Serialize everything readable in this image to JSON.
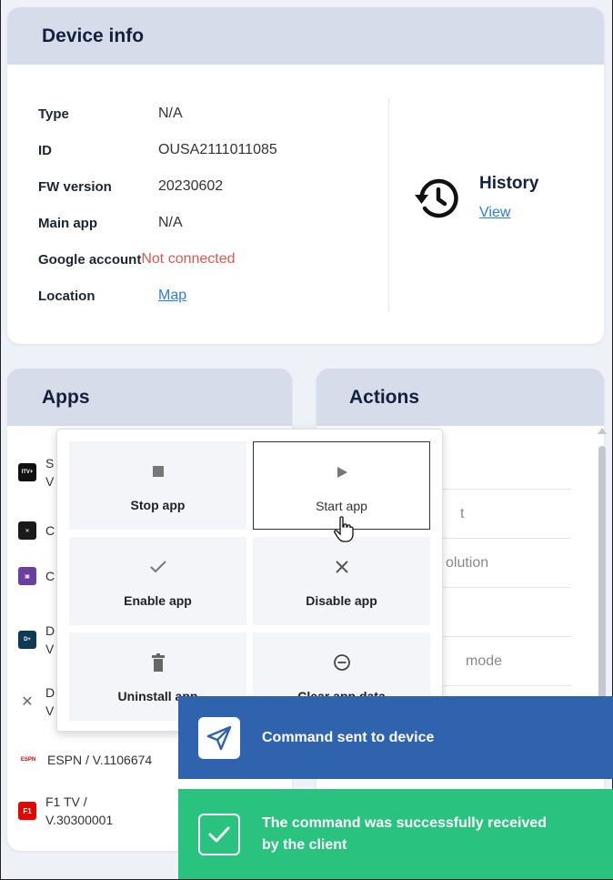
{
  "device_info": {
    "title": "Device info",
    "rows": [
      {
        "key": "Type",
        "value": "N/A"
      },
      {
        "key": "ID",
        "value": "OUSA2111011085"
      },
      {
        "key": "FW version",
        "value": "20230602"
      },
      {
        "key": "Main app",
        "value": "N/A"
      },
      {
        "key": "Google account",
        "value": "Not connected"
      },
      {
        "key": "Location",
        "value": "Map"
      }
    ],
    "history": {
      "title": "History",
      "link": "View"
    }
  },
  "apps": {
    "title": "Apps",
    "items": [
      {
        "name": "S",
        "sub": "V",
        "logo_color": "#111111",
        "logo_text": "ITV+"
      },
      {
        "name": "C",
        "sub": "",
        "logo_color": "#1a1a1a",
        "logo_text": "✕"
      },
      {
        "name": "C",
        "sub": "",
        "logo_color": "#6b3fa0",
        "logo_text": "▣"
      },
      {
        "name": "D",
        "sub": "V",
        "logo_color": "#0e3a54",
        "logo_text": "D+"
      },
      {
        "name": "D",
        "sub": "V",
        "logo_color": "#ffffff",
        "logo_text": "🛠"
      },
      {
        "name": "ESPN / V.1106674",
        "sub": "",
        "logo_color": "#ffffff",
        "logo_text": "ESPN"
      },
      {
        "name": "F1 TV /",
        "sub": "V.30300001",
        "logo_color": "#e10600",
        "logo_text": "F1"
      }
    ]
  },
  "actions": {
    "title": "Actions",
    "items": [
      "",
      "t",
      "olution",
      "",
      "mode",
      ""
    ]
  },
  "menu": {
    "tiles": [
      {
        "label": "Stop app",
        "icon": "stop-icon"
      },
      {
        "label": "Start app",
        "icon": "play-icon"
      },
      {
        "label": "Enable app",
        "icon": "check-icon"
      },
      {
        "label": "Disable app",
        "icon": "close-icon"
      },
      {
        "label": "Uninstall app",
        "icon": "trash-icon"
      },
      {
        "label": "Clear app data",
        "icon": "minus-circle-icon"
      }
    ]
  },
  "toasts": {
    "sent": "Command sent to device",
    "received_line1": "The command was successfully received",
    "received_line2": "by the client"
  },
  "colors": {
    "header_bg": "#d6dce9",
    "link": "#2c7be5",
    "error": "#e0574f",
    "toast_blue": "#2f63ad",
    "toast_green": "#29c27e"
  }
}
